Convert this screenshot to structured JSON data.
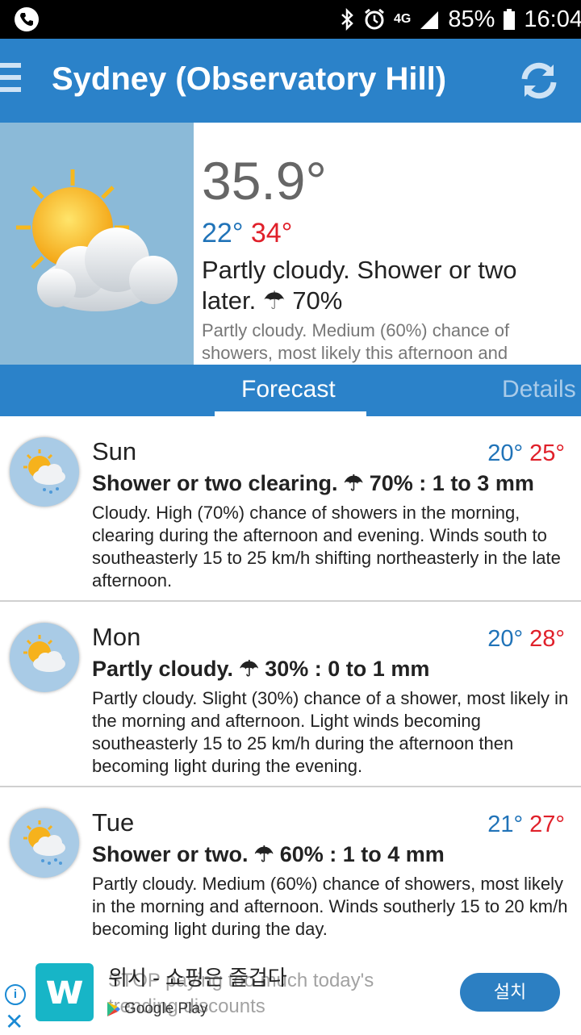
{
  "status_bar": {
    "battery": "85%",
    "time": "16:04",
    "network": "4G",
    "icons": [
      "phone-icon",
      "bluetooth-icon",
      "alarm-icon",
      "signal-icon",
      "battery-icon"
    ]
  },
  "app_bar": {
    "title": "Sydney (Observatory Hill)",
    "icons": [
      "menu-icon",
      "refresh-icon"
    ]
  },
  "current": {
    "temperature": "35.9°",
    "min": "22°",
    "max": "34°",
    "summary": "Partly cloudy. Shower or two later. ☂ 70%",
    "detail": "Partly cloudy. Medium (60%) chance of showers, most likely this afternoon and"
  },
  "tabs": {
    "forecast": "Forecast",
    "details": "Details",
    "active": "Forecast"
  },
  "forecast": [
    {
      "day": "Sun",
      "min": "20°",
      "max": "25°",
      "summary": "Shower or two clearing. ☂ 70% : 1 to 3 mm",
      "description": "Cloudy. High (70%) chance of showers in the morning, clearing during the afternoon and evening. Winds south to southeasterly 15 to 25 km/h shifting northeasterly in the late afternoon.",
      "icon": "sun-cloud-rain-icon"
    },
    {
      "day": "Mon",
      "min": "20°",
      "max": "28°",
      "summary": "Partly cloudy. ☂ 30% : 0 to 1 mm",
      "description": "Partly cloudy. Slight (30%) chance of a shower, most likely in the morning and afternoon. Light winds becoming southeasterly 15 to 25 km/h during the afternoon then becoming light during the evening.",
      "icon": "sun-cloud-icon"
    },
    {
      "day": "Tue",
      "min": "21°",
      "max": "27°",
      "summary": "Shower or two. ☂ 60% : 1 to 4 mm",
      "description": "Partly cloudy. Medium (60%) chance of showers, most likely in the morning and afternoon. Winds southerly 15 to 20 km/h becoming light during the day.",
      "icon": "sun-cloud-rain-icon"
    }
  ],
  "ad": {
    "title": "위시 - 쇼핑은 즐겁다",
    "subtitle": "STOP paying too much today's trending discounts",
    "store": "Google Play",
    "install": "설치",
    "logo_letter": "w"
  },
  "colors": {
    "primary": "#2b82c9",
    "min_temp": "#2073b8",
    "max_temp": "#e0202a"
  }
}
